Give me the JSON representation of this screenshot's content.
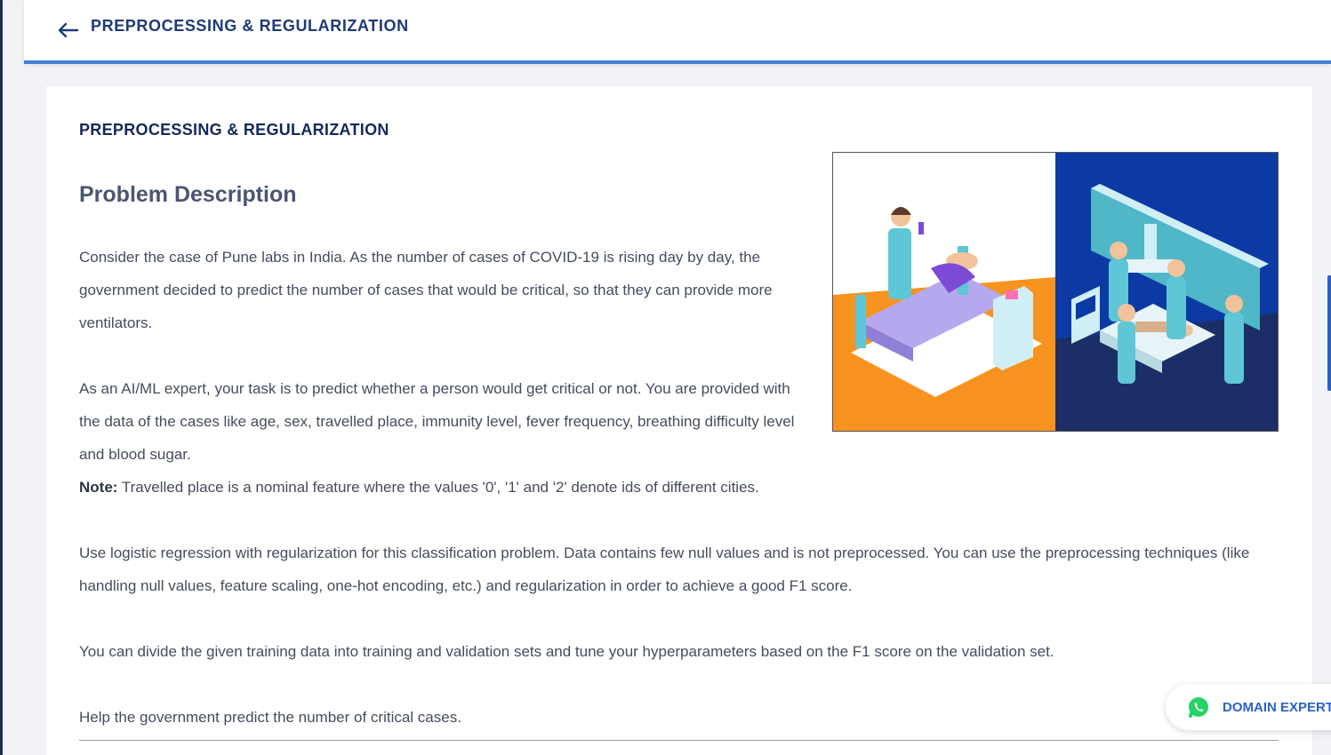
{
  "header": {
    "back_icon": "arrow-left-icon",
    "title": "PREPROCESSING & REGULARIZATION"
  },
  "card": {
    "heading": "PREPROCESSING & REGULARIZATION",
    "problem_title": "Problem Description",
    "paragraph_1": "Consider the case of Pune labs in India. As the number of cases of COVID-19 is rising day by day, the government decided to predict the number of cases that would be critical, so that they can provide more ventilators.",
    "paragraph_2": "As an AI/ML expert, your task is to predict whether a person would get critical or not. You are provided with the data of the cases like age, sex, travelled place, immunity level, fever frequency, breathing difficulty level and blood sugar.",
    "note_label": "Note:",
    "note_text": " Travelled place is a nominal feature where the values '0', '1' and '2' denote ids of different cities.",
    "paragraph_3": "Use logistic regression with regularization for this classification problem. Data contains few null values and is not preprocessed. You can use the preprocessing techniques (like handling null values, feature scaling, one-hot encoding, etc.) and regularization in order to achieve a good F1 score.",
    "paragraph_4": "You can divide the given training data into training and validation sets and tune your hyperparameters based on the F1 score on the validation set.",
    "paragraph_5": "Help the government predict the number of critical cases."
  },
  "illustration": {
    "name": "hospital-covid-illustration",
    "left_bg": "#ffffff",
    "left_floor": "#f7931e",
    "right_bg": "#0b3aa5",
    "right_floor": "#1c2e66"
  },
  "floating": {
    "icon": "whatsapp-icon",
    "label": "DOMAIN EXPERT"
  },
  "colors": {
    "accent": "#3f7fd9",
    "title": "#1e3a78",
    "text": "#454c5e",
    "whatsapp": "#25d366"
  }
}
